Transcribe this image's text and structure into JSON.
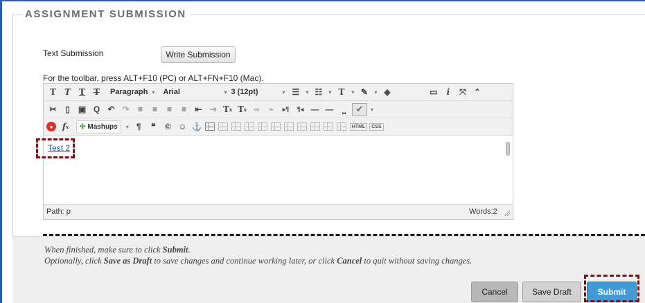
{
  "section": {
    "legend": "ASSIGNMENT SUBMISSION"
  },
  "text_submission": {
    "label": "Text Submission",
    "write_button": "Write Submission"
  },
  "editor": {
    "toolbar_hint": "For the toolbar, press ALT+F10 (PC) or ALT+FN+F10 (Mac).",
    "toolbar1": {
      "format_select": "Paragraph",
      "font_select": "Arial",
      "size_select": "3 (12pt)"
    },
    "toolbar3": {
      "mashups_label": "Mashups",
      "html_label": "HTML",
      "css_label": "CSS"
    },
    "content": {
      "link_text": "Test 2"
    },
    "status": {
      "path": "Path: p",
      "words": "Words:2"
    }
  },
  "instructions": {
    "line1_pre": "When finished, make sure to click ",
    "line1_bold": "Submit",
    "line1_post": ".",
    "line2_a": "Optionally, click ",
    "line2_b": "Save as Draft",
    "line2_c": " to save changes and continue working later, or click ",
    "line2_d": "Cancel",
    "line2_e": " to quit without saving changes."
  },
  "buttons": {
    "cancel": "Cancel",
    "save_draft": "Save Draft",
    "submit": "Submit"
  },
  "colors": {
    "submit": "#3f9ad6",
    "highlight_dash": "#7a1414",
    "frame_border": "#2a5fb0"
  }
}
